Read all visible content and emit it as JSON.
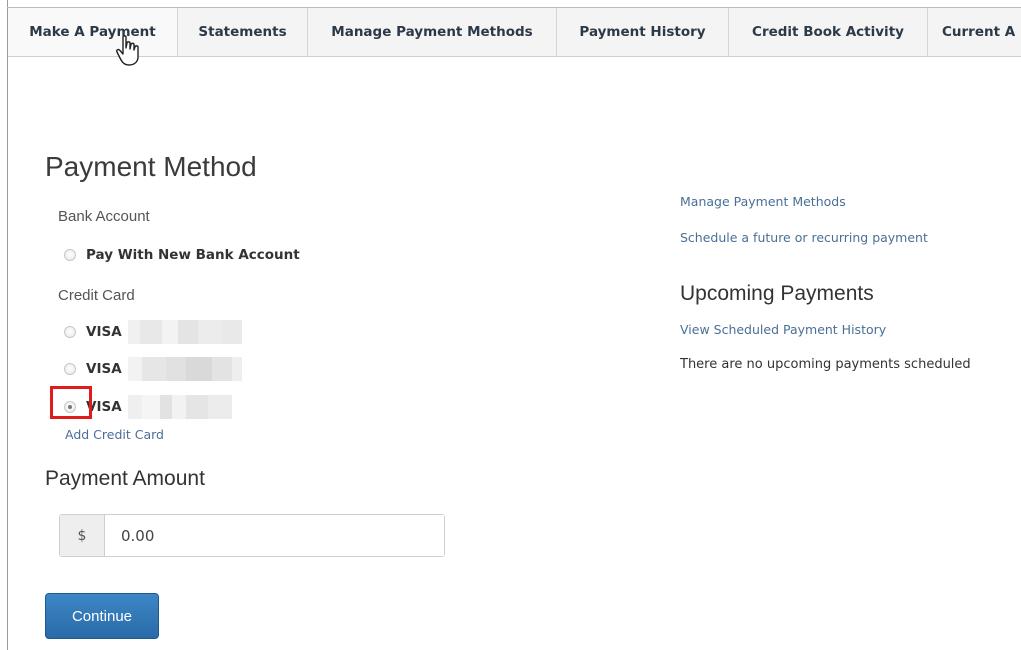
{
  "tabs": [
    {
      "label": "Make A Payment"
    },
    {
      "label": "Statements"
    },
    {
      "label": "Manage Payment Methods"
    },
    {
      "label": "Payment History"
    },
    {
      "label": "Credit Book Activity"
    },
    {
      "label": "Current A"
    }
  ],
  "payment_method": {
    "title": "Payment Method",
    "bank_account_label": "Bank Account",
    "new_bank_option": "Pay With New Bank Account",
    "credit_card_label": "Credit Card",
    "cards": [
      {
        "brand": "VISA",
        "selected": false
      },
      {
        "brand": "VISA",
        "selected": false
      },
      {
        "brand": "VISA",
        "selected": true
      }
    ],
    "add_card_link": "Add Credit Card"
  },
  "payment_amount": {
    "title": "Payment Amount",
    "currency_symbol": "$",
    "value": "0.00"
  },
  "continue_label": "Continue",
  "sidebar": {
    "manage_link": "Manage Payment Methods",
    "schedule_link": "Schedule a future or recurring payment",
    "upcoming_title": "Upcoming Payments",
    "history_link": "View Scheduled Payment History",
    "empty_message": "There are no upcoming payments scheduled"
  },
  "colors": {
    "highlight": "#e01b1b",
    "link": "#4a6f96",
    "primary_button": "#2a6aa8"
  }
}
